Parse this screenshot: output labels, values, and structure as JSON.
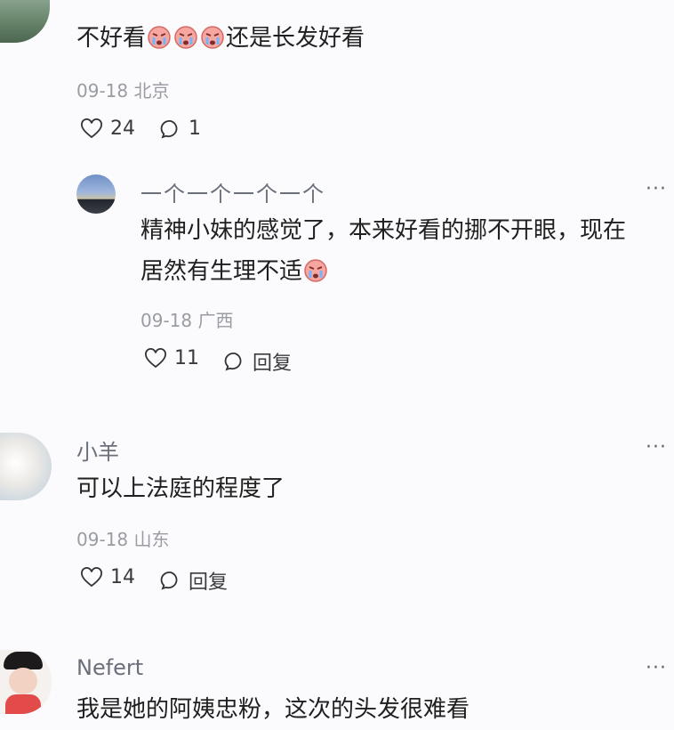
{
  "comments": [
    {
      "name": "",
      "text_before": "不好看",
      "text_after": "还是长发好看",
      "meta": "09-18 北京",
      "likes": "24",
      "replies": "1"
    },
    {
      "name": "一个一个一个一个",
      "text_line1": "精神小妹的感觉了，本来好看的挪不开眼，现在",
      "text_line2": "居然有生理不适",
      "meta": "09-18 广西",
      "likes": "11",
      "reply_label": "回复",
      "more": "···"
    },
    {
      "name": "小羊",
      "text": "可以上法庭的程度了",
      "meta": "09-18 山东",
      "likes": "14",
      "reply_label": "回复",
      "more": "···"
    },
    {
      "name": "Nefert",
      "text": "我是她的阿姨忠粉，这次的头发很难看",
      "more": "···"
    }
  ],
  "icons": {
    "like": "heart-icon",
    "comment": "comment-bubble-icon",
    "emoji": "crying-face-emoji-icon",
    "more": "more-icon"
  },
  "colors": {
    "background": "#fbfbfd",
    "text": "#1f1f1f",
    "name": "#6b6f7a",
    "meta": "#9a9ca3"
  }
}
